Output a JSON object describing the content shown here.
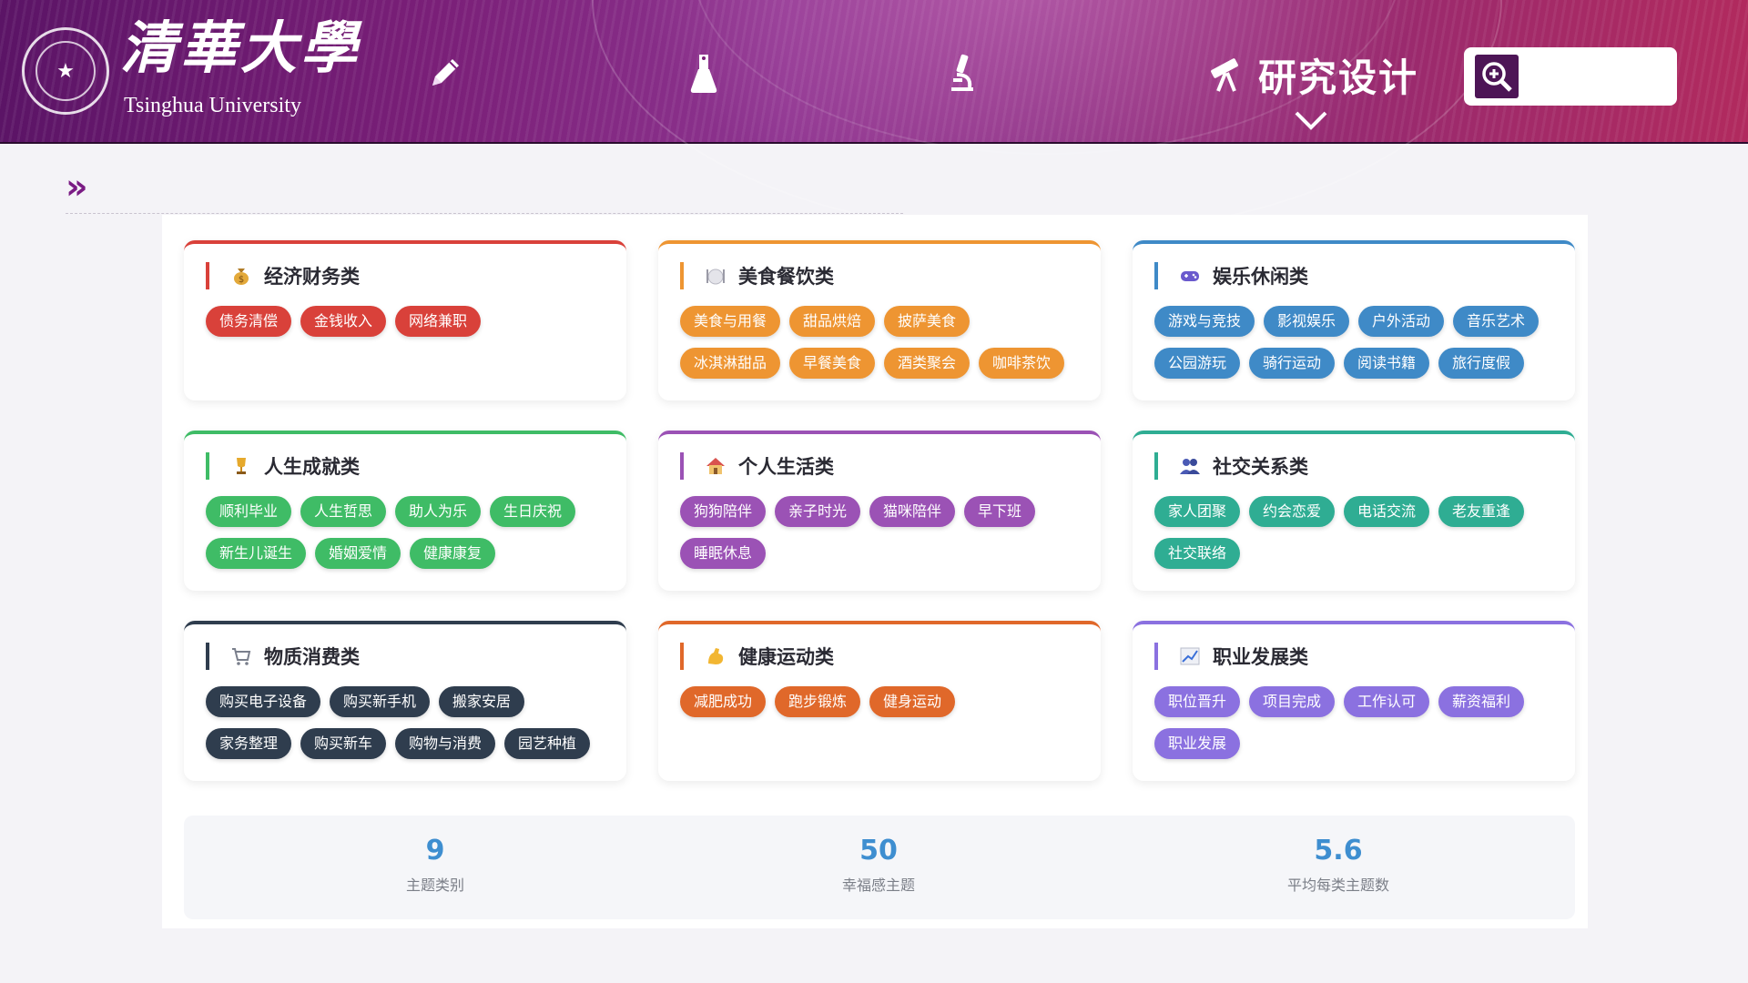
{
  "header": {
    "logo_cn": "清華大學",
    "logo_en": "Tsinghua University",
    "nav_icons": [
      "pencil-icon",
      "flask-icon",
      "microscope-icon"
    ],
    "active_nav_label": "研究设计",
    "active_nav_icon": "telescope-icon",
    "search_placeholder": ""
  },
  "breadcrumb": {
    "symbol": "»"
  },
  "categories": [
    {
      "title": "经济财务类",
      "icon": "money-bag-icon",
      "color": "#d9413a",
      "tags": [
        "债务清偿",
        "金钱收入",
        "网络兼职"
      ]
    },
    {
      "title": "美食餐饮类",
      "icon": "plate-icon",
      "color": "#ee9532",
      "tags": [
        "美食与用餐",
        "甜品烘焙",
        "披萨美食",
        "冰淇淋甜品",
        "早餐美食",
        "酒类聚会",
        "咖啡茶饮"
      ]
    },
    {
      "title": "娱乐休闲类",
      "icon": "gamepad-icon",
      "color": "#3f8ac7",
      "tags": [
        "游戏与竞技",
        "影视娱乐",
        "户外活动",
        "音乐艺术",
        "公园游玩",
        "骑行运动",
        "阅读书籍",
        "旅行度假"
      ]
    },
    {
      "title": "人生成就类",
      "icon": "trophy-icon",
      "color": "#3fbc66",
      "tags": [
        "顺利毕业",
        "人生哲思",
        "助人为乐",
        "生日庆祝",
        "新生儿诞生",
        "婚姻爱情",
        "健康康复"
      ]
    },
    {
      "title": "个人生活类",
      "icon": "house-icon",
      "color": "#9b52b5",
      "tags": [
        "狗狗陪伴",
        "亲子时光",
        "猫咪陪伴",
        "早下班",
        "睡眠休息"
      ]
    },
    {
      "title": "社交关系类",
      "icon": "people-icon",
      "color": "#2fad93",
      "tags": [
        "家人团聚",
        "约会恋爱",
        "电话交流",
        "老友重逢",
        "社交联络"
      ]
    },
    {
      "title": "物质消费类",
      "icon": "cart-icon",
      "color": "#2f3d4e",
      "tags": [
        "购买电子设备",
        "购买新手机",
        "搬家安居",
        "家务整理",
        "购买新车",
        "购物与消费",
        "园艺种植"
      ]
    },
    {
      "title": "健康运动类",
      "icon": "flexed-arm-icon",
      "color": "#e0682a",
      "tags": [
        "减肥成功",
        "跑步锻炼",
        "健身运动"
      ]
    },
    {
      "title": "职业发展类",
      "icon": "chart-up-icon",
      "color": "#8b71e0",
      "tags": [
        "职位晋升",
        "项目完成",
        "工作认可",
        "薪资福利",
        "职业发展"
      ]
    }
  ],
  "stats": [
    {
      "value": "9",
      "label": "主题类别"
    },
    {
      "value": "50",
      "label": "幸福感主题"
    },
    {
      "value": "5.6",
      "label": "平均每类主题数"
    }
  ]
}
